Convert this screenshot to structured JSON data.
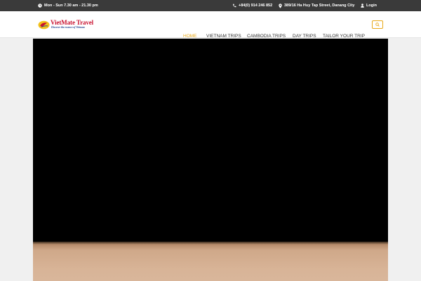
{
  "topbar": {
    "hours": "Mon - Sun 7.30 am - 21.30 pm",
    "phone": "+84(0) 914 246 852",
    "address": "389/16 Ha Huy Tap Street, Danang City",
    "login": "Login",
    "icons": [
      "clock-icon",
      "phone-icon",
      "location-pin-icon",
      "user-icon"
    ]
  },
  "logo": {
    "name": "VietMate Travel",
    "tagline": "Discover the essence of Vietnam"
  },
  "nav": {
    "items": [
      {
        "label": "HOME",
        "active": true
      },
      {
        "label": "VIETNAM TRIPS",
        "active": false
      },
      {
        "label": "CAMBODIA TRIPS",
        "active": false
      },
      {
        "label": "DAY TRIPS",
        "active": false
      },
      {
        "label": "TAILOR YOUR TRIP",
        "active": false
      }
    ],
    "search_icon": "search-icon"
  },
  "colors": {
    "accent": "#e8a817",
    "topbar_bg": "#3a3a3a",
    "hero_bg": "#000000",
    "brand_red": "#c8102e",
    "brand_blue": "#1a3c8c"
  }
}
